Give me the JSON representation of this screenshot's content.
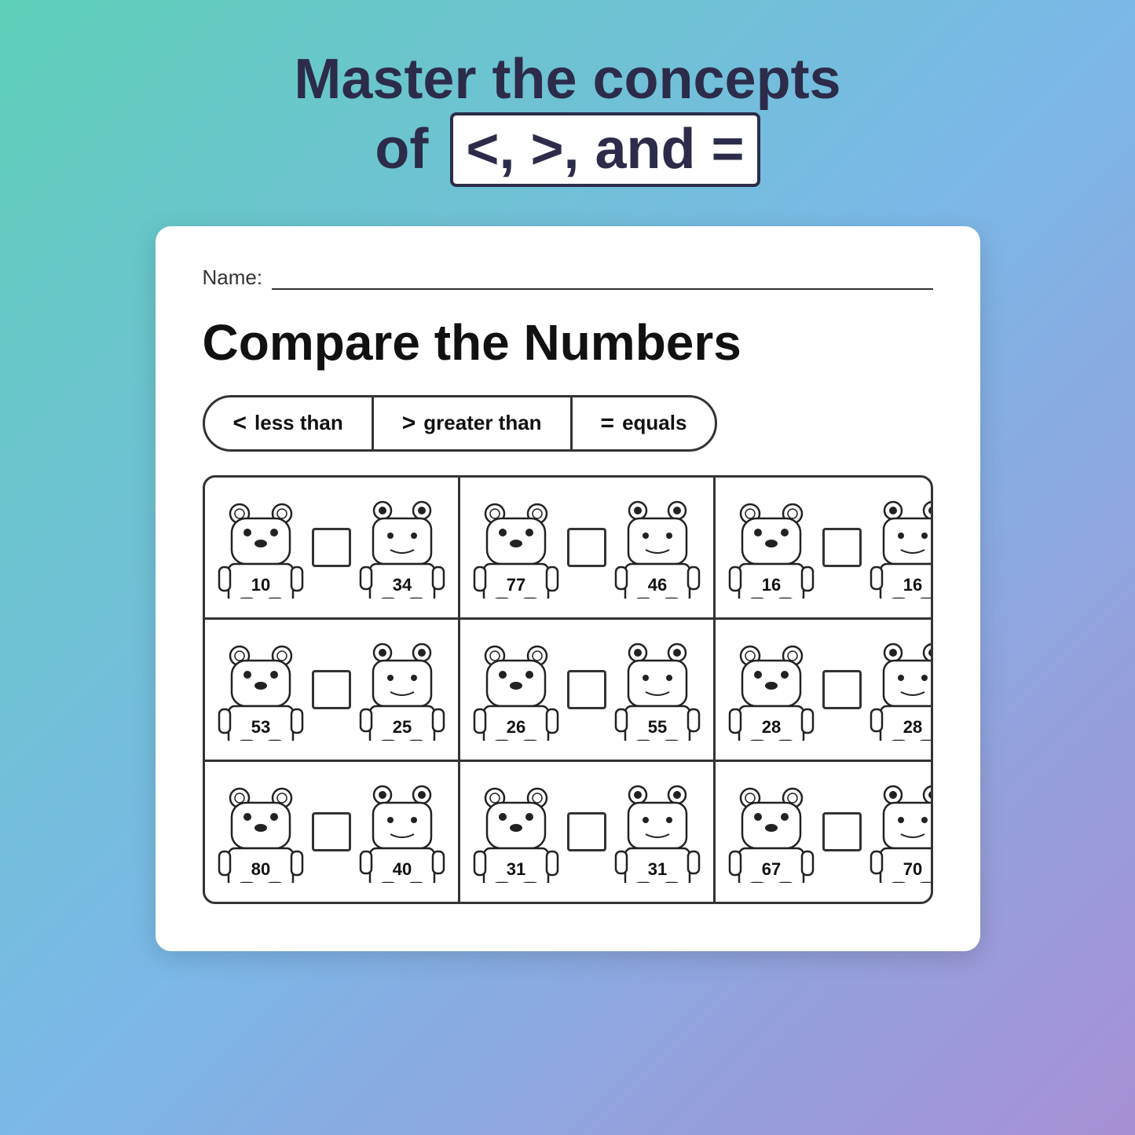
{
  "header": {
    "line1": "Master the concepts",
    "line2_pre": "of ",
    "line2_symbols": "<, >, and =",
    "line2_post": ""
  },
  "name_label": "Name:",
  "worksheet_title": "Compare the Numbers",
  "legend": [
    {
      "symbol": "<",
      "label": "less than"
    },
    {
      "symbol": ">",
      "label": "greater than"
    },
    {
      "symbol": "=",
      "label": "equals"
    }
  ],
  "rows": [
    [
      {
        "left": "10",
        "right": "34"
      },
      {
        "left": "77",
        "right": "46"
      },
      {
        "left": "16",
        "right": "16"
      }
    ],
    [
      {
        "left": "53",
        "right": "25"
      },
      {
        "left": "26",
        "right": "55"
      },
      {
        "left": "28",
        "right": "28"
      }
    ],
    [
      {
        "left": "80",
        "right": "40"
      },
      {
        "left": "31",
        "right": "31"
      },
      {
        "left": "67",
        "right": "70"
      }
    ]
  ],
  "colors": {
    "background_start": "#5ecfb8",
    "background_end": "#a78fd4",
    "text_dark": "#2c2c4a",
    "white": "#ffffff"
  }
}
